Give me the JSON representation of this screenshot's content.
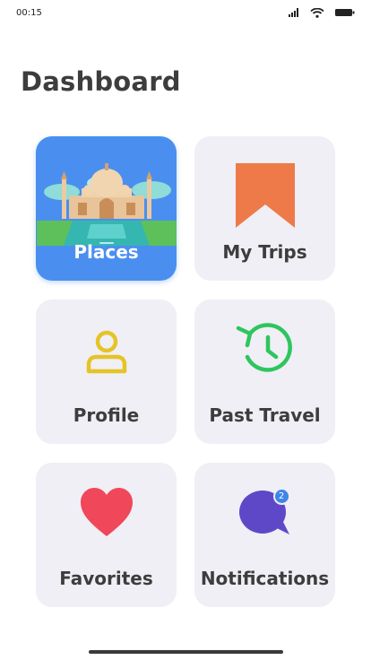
{
  "status_bar": {
    "time": "00:15"
  },
  "header": {
    "title": "Dashboard"
  },
  "tiles": [
    {
      "label": "Places",
      "icon": "taj-mahal-icon",
      "active": true
    },
    {
      "label": "My Trips",
      "icon": "bookmark-icon"
    },
    {
      "label": "Profile",
      "icon": "user-icon"
    },
    {
      "label": "Past Travel",
      "icon": "history-clock-icon"
    },
    {
      "label": "Favorites",
      "icon": "heart-icon"
    },
    {
      "label": "Notifications",
      "icon": "chat-bubble-icon",
      "badge": "2"
    }
  ],
  "colors": {
    "active_tile": "#4a8ff0",
    "tile_bg": "#efeff5",
    "bookmark": "#ee7a4a",
    "profile": "#e6c326",
    "history": "#2ec55e",
    "heart": "#f0475a",
    "chat": "#5f48c8",
    "badge": "#3d86e8"
  }
}
